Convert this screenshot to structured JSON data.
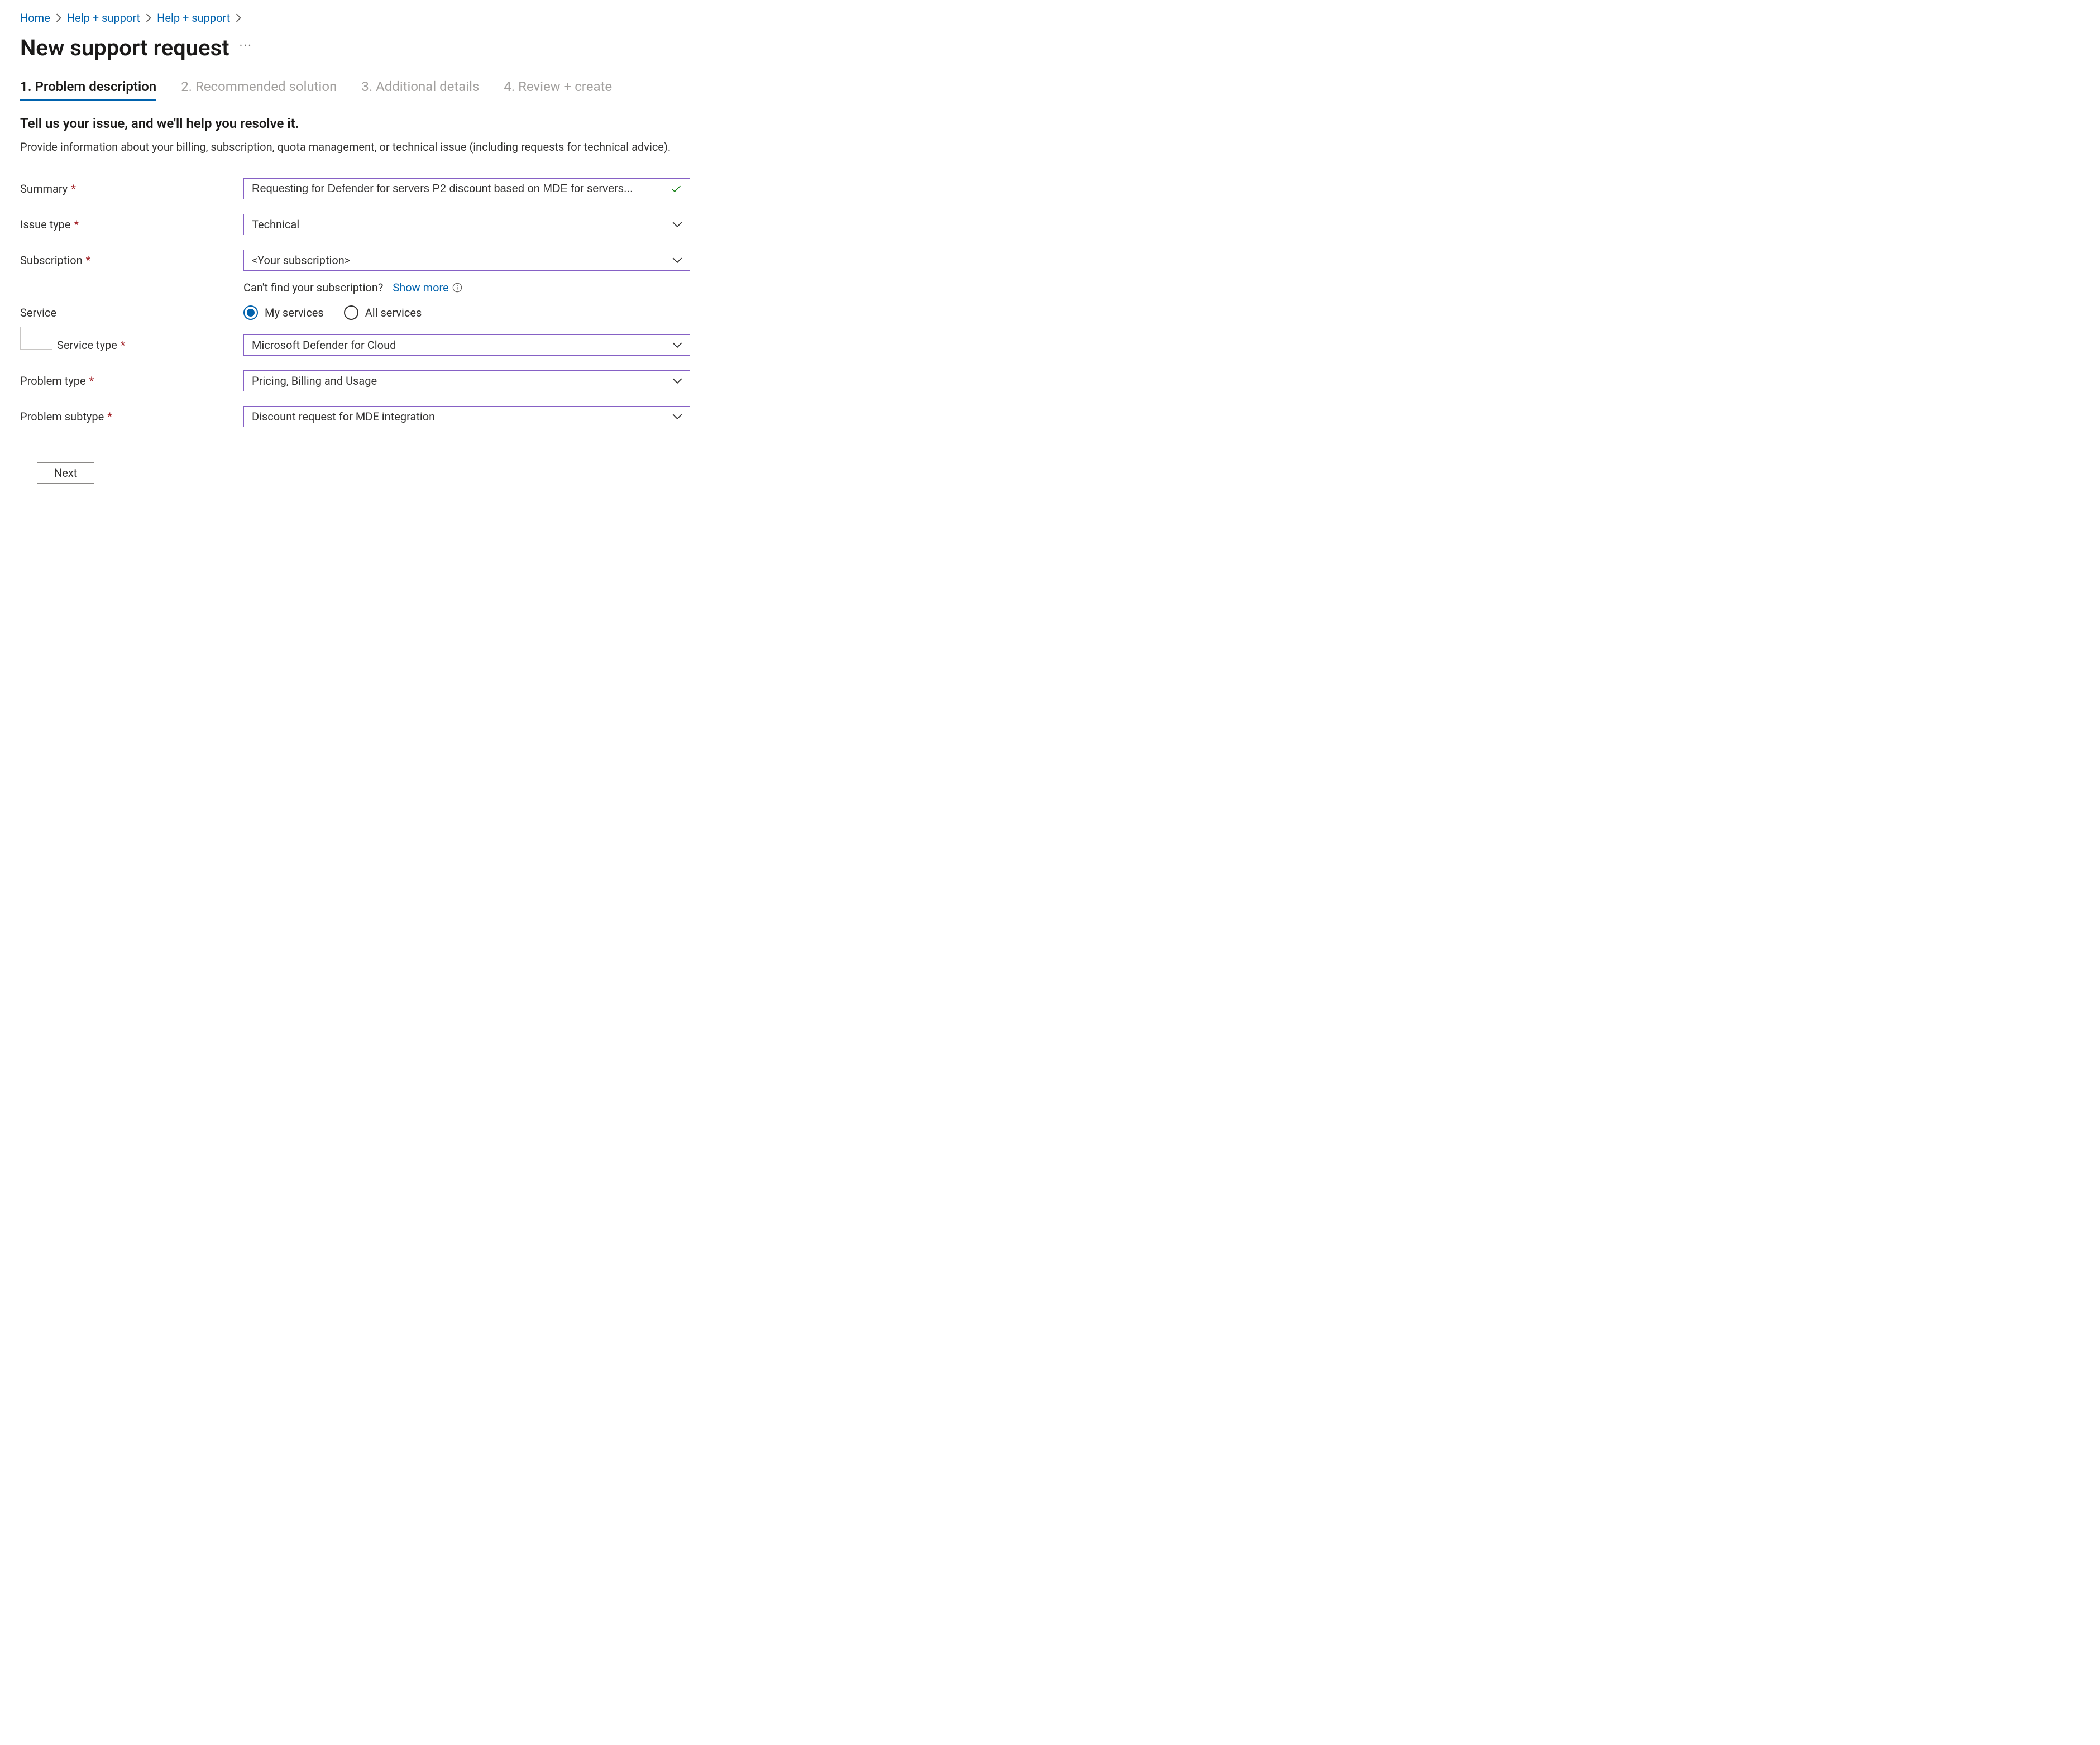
{
  "breadcrumb": [
    {
      "label": "Home"
    },
    {
      "label": "Help + support"
    },
    {
      "label": "Help + support"
    }
  ],
  "page_title": "New support request",
  "tabs": [
    {
      "label": "1. Problem description",
      "active": true
    },
    {
      "label": "2. Recommended solution",
      "active": false
    },
    {
      "label": "3. Additional details",
      "active": false
    },
    {
      "label": "4. Review + create",
      "active": false
    }
  ],
  "subheading": "Tell us your issue, and we'll help you resolve it.",
  "helper_text": "Provide information about your billing, subscription, quota management, or technical issue (including requests for technical advice).",
  "form": {
    "summary_label": "Summary",
    "summary_value": "Requesting for Defender for servers P2 discount based on MDE for servers...",
    "issue_type_label": "Issue type",
    "issue_type_value": "Technical",
    "subscription_label": "Subscription",
    "subscription_value": "<Your subscription>",
    "subscription_hint_prefix": "Can't find your subscription?",
    "subscription_hint_link": "Show more",
    "service_label": "Service",
    "service_radio_my": "My services",
    "service_radio_all": "All services",
    "service_type_label": "Service type",
    "service_type_value": "Microsoft Defender for Cloud",
    "problem_type_label": "Problem type",
    "problem_type_value": "Pricing, Billing and Usage",
    "problem_subtype_label": "Problem subtype",
    "problem_subtype_value": "Discount request for MDE integration"
  },
  "next_button": "Next"
}
